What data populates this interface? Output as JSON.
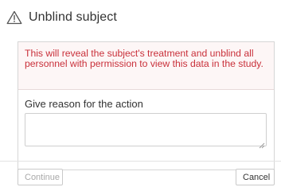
{
  "dialog": {
    "title": "Unblind subject",
    "title_icon": "warning-triangle-icon",
    "warning_text": "This will reveal the subject's treatment and unblind all personnel with permission to view this data in the study.",
    "reason_label": "Give reason for the action",
    "reason_value": "",
    "continue_label": "Continue",
    "cancel_label": "Cancel"
  },
  "colors": {
    "warning_text": "#c9303a",
    "warning_background": "#fdf6f6",
    "disabled_text": "#a9a9a9",
    "text": "#333333"
  }
}
